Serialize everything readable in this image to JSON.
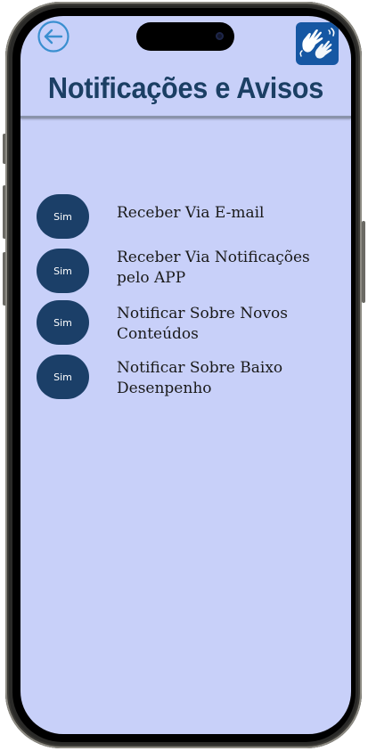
{
  "header": {
    "title": "Notificações e Avisos",
    "back_icon": "arrow-left-circle-icon",
    "accessibility_icon": "sign-language-hands-icon"
  },
  "options": [
    {
      "toggle_label": "Sim",
      "label": "Receber Via E-mail"
    },
    {
      "toggle_label": "Sim",
      "label": "Receber Via Notificações\npelo APP"
    },
    {
      "toggle_label": "Sim",
      "label": "Notificar  Sobre Novos\nConteúdos"
    },
    {
      "toggle_label": "Sim",
      "label": "Notificar  Sobre Baixo\nDesenpenho"
    }
  ],
  "colors": {
    "background": "#c8d0f9",
    "accent": "#1b3f68",
    "title": "#1b3f64",
    "back_icon": "#3a8fd0",
    "libras_button": "#1657a3"
  }
}
